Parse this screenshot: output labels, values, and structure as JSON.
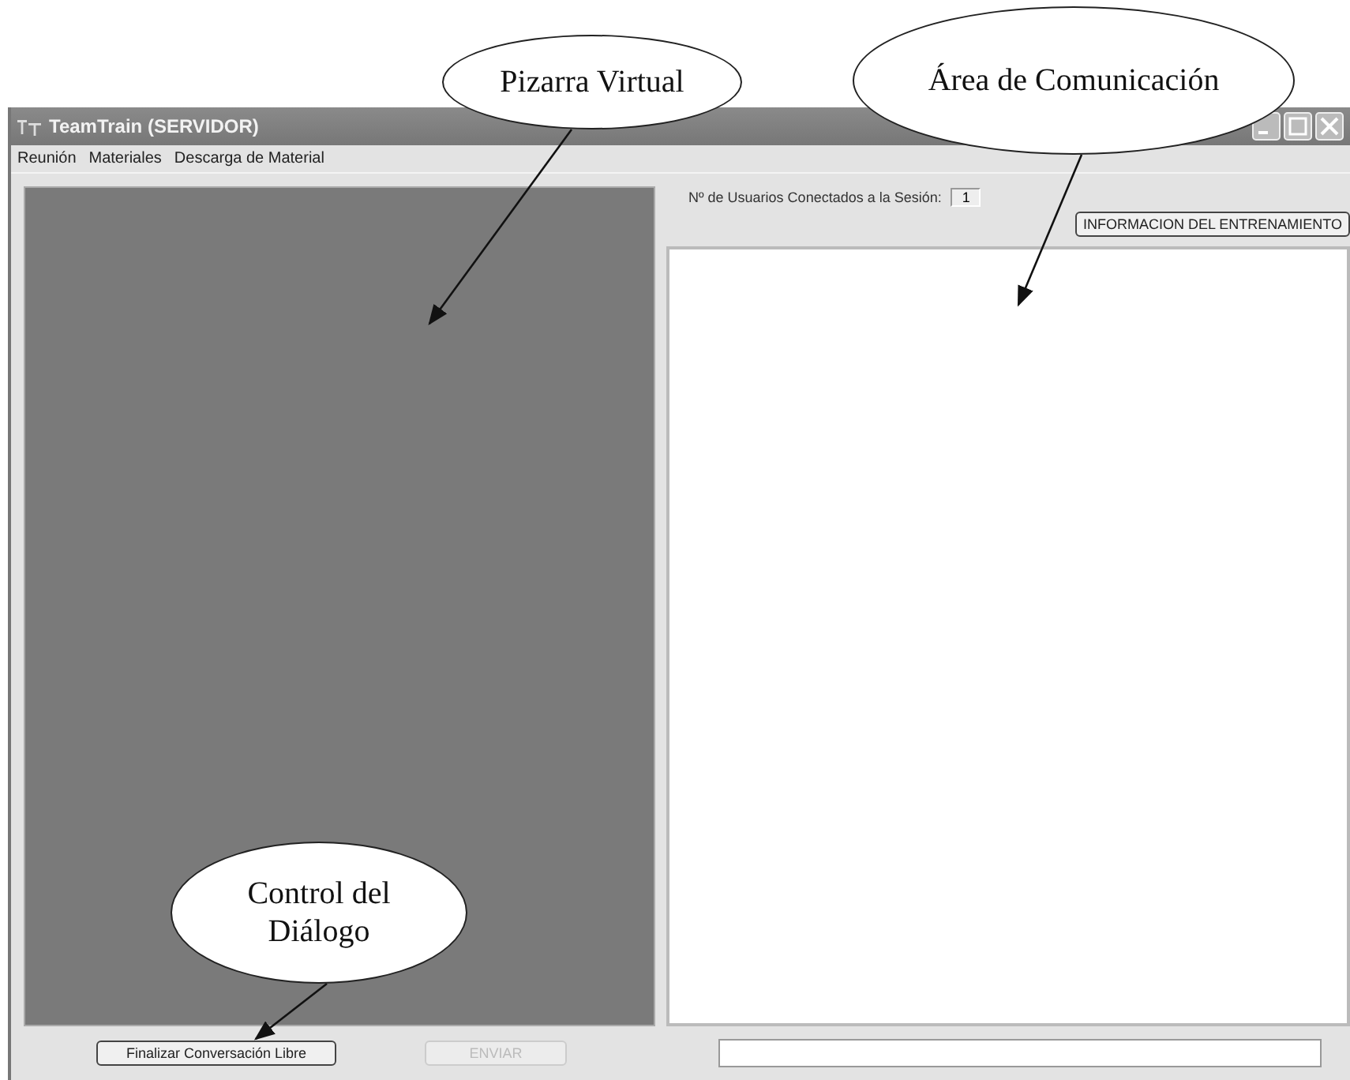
{
  "window": {
    "title": "TeamTrain (SERVIDOR)"
  },
  "menu": [
    {
      "label": "Reunión"
    },
    {
      "label": "Materiales"
    },
    {
      "label": "Descarga de Material"
    }
  ],
  "users": {
    "label": "Nº de Usuarios Conectados a la Sesión:",
    "value": "1"
  },
  "info_button": {
    "label": "INFORMACION DEL ENTRENAMIENTO"
  },
  "bottom_buttons": [
    {
      "label": "Finalizar Conversación Libre",
      "disabled": false
    },
    {
      "label": "ENVIAR",
      "disabled": true
    }
  ],
  "callouts": [
    {
      "text": "Pizarra Virtual"
    },
    {
      "text": "Área de Comunicación"
    },
    {
      "text": "Control del Diálogo"
    }
  ]
}
